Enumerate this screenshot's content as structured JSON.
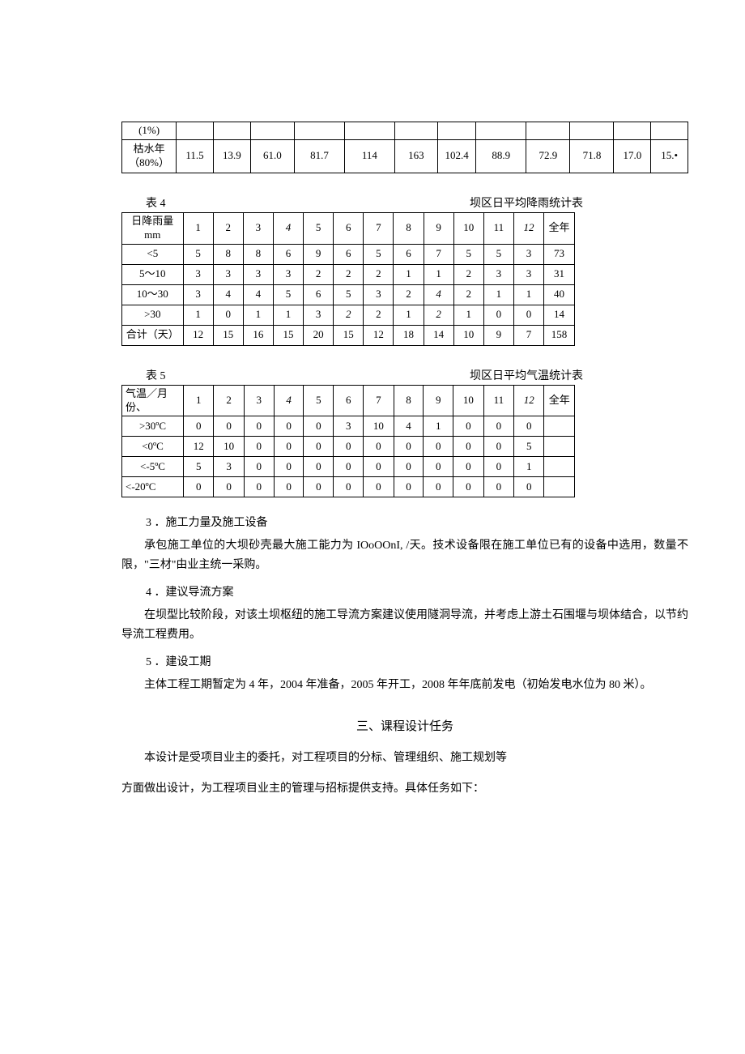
{
  "table3": {
    "rows": [
      {
        "label": "(1%)",
        "vals": [
          "",
          "",
          "",
          "",
          "",
          "",
          "",
          "",
          "",
          "",
          "",
          ""
        ]
      },
      {
        "label": "枯水年（80%）",
        "vals": [
          "11.5",
          "13.9",
          "61.0",
          "81.7",
          "114",
          "163",
          "102.4",
          "88.9",
          "72.9",
          "71.8",
          "17.0",
          "15.•"
        ]
      }
    ]
  },
  "table4": {
    "caption_left": "表 4",
    "caption_right": "坝区日平均降雨统计表",
    "header": "日降雨量mm",
    "months": [
      "1",
      "2",
      "3",
      "4",
      "5",
      "6",
      "7",
      "8",
      "9",
      "10",
      "11",
      "12",
      "全年"
    ],
    "rows": [
      {
        "label": "<5",
        "vals": [
          "5",
          "8",
          "8",
          "6",
          "9",
          "6",
          "5",
          "6",
          "7",
          "5",
          "5",
          "3",
          "73"
        ]
      },
      {
        "label": "5～10",
        "vals": [
          "3",
          "3",
          "3",
          "3",
          "2",
          "2",
          "2",
          "1",
          "1",
          "2",
          "3",
          "3",
          "31"
        ]
      },
      {
        "label": "10～30",
        "vals": [
          "3",
          "4",
          "4",
          "5",
          "6",
          "5",
          "3",
          "2",
          "4",
          "2",
          "1",
          "1",
          "40"
        ]
      },
      {
        "label": ">30",
        "vals": [
          "1",
          "0",
          "1",
          "1",
          "3",
          "2",
          "2",
          "1",
          "2",
          "1",
          "0",
          "0",
          "14"
        ]
      },
      {
        "label": "合计（天）",
        "vals": [
          "12",
          "15",
          "16",
          "15",
          "20",
          "15",
          "12",
          "18",
          "14",
          "10",
          "9",
          "7",
          "158"
        ]
      }
    ]
  },
  "table5": {
    "caption_left": "表 5",
    "caption_right": "坝区日平均气温统计表",
    "header": "气温／月份、",
    "months": [
      "1",
      "2",
      "3",
      "4",
      "5",
      "6",
      "7",
      "8",
      "9",
      "10",
      "11",
      "12",
      "全年"
    ],
    "rows": [
      {
        "label": ">30ºC",
        "vals": [
          "0",
          "0",
          "0",
          "0",
          "0",
          "3",
          "10",
          "4",
          "1",
          "0",
          "0",
          "0",
          ""
        ]
      },
      {
        "label": "<0ºC",
        "vals": [
          "12",
          "10",
          "0",
          "0",
          "0",
          "0",
          "0",
          "0",
          "0",
          "0",
          "0",
          "5",
          ""
        ]
      },
      {
        "label": "<-5ºC",
        "vals": [
          "5",
          "3",
          "0",
          "0",
          "0",
          "0",
          "0",
          "0",
          "0",
          "0",
          "0",
          "1",
          ""
        ]
      },
      {
        "label": "<-20ºC",
        "vals": [
          "0",
          "0",
          "0",
          "0",
          "0",
          "0",
          "0",
          "0",
          "0",
          "0",
          "0",
          "0",
          ""
        ]
      }
    ]
  },
  "sections": {
    "s3": {
      "num": "3",
      "title": "．施工力量及施工设备",
      "p1": "承包施工单位的大坝砂壳最大施工能力为 IOoOOnI, /天。技术设备限在施工单位已有的设备中选用，数量不限，\"三材\"由业主统一采购。"
    },
    "s4": {
      "num": "4",
      "title": "．建议导流方案",
      "p1": "在坝型比较阶段，对该土坝枢纽的施工导流方案建议使用隧洞导流，并考虑上游土石围堰与坝体结合，以节约导流工程费用。"
    },
    "s5": {
      "num": "5",
      "title": "．建设工期",
      "p1": "主体工程工期暂定为 4 年，2004 年准备，2005 年开工，2008 年年底前发电（初始发电水位为 80 米）。"
    }
  },
  "task": {
    "title": "三、课程设计任务",
    "p1": "本设计是受项目业主的委托，对工程项目的分标、管理组织、施工规划等",
    "p2": "方面做出设计，为工程项目业主的管理与招标提供支持。具体任务如下："
  }
}
